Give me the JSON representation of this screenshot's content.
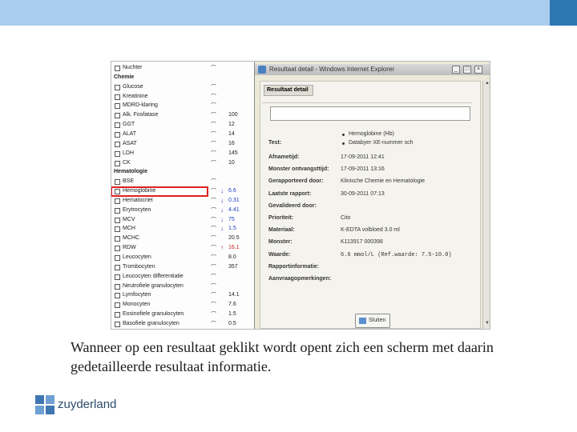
{
  "results_list": {
    "rows": [
      {
        "name": "Nuchter",
        "type": "item",
        "value": "",
        "arrow": ""
      },
      {
        "name": "Chemie",
        "type": "category",
        "value": "",
        "arrow": ""
      },
      {
        "name": "Glucose",
        "type": "item",
        "value": "",
        "arrow": ""
      },
      {
        "name": "Kreatinine",
        "type": "item",
        "value": "",
        "arrow": ""
      },
      {
        "name": "MDRD-klaring",
        "type": "item",
        "value": "",
        "arrow": ""
      },
      {
        "name": "Alk. Fosfatase",
        "type": "item",
        "value": "100",
        "arrow": ""
      },
      {
        "name": "GGT",
        "type": "item",
        "value": "12",
        "arrow": ""
      },
      {
        "name": "ALAT",
        "type": "item",
        "value": "14",
        "arrow": ""
      },
      {
        "name": "ASAT",
        "type": "item",
        "value": "16",
        "arrow": ""
      },
      {
        "name": "LDH",
        "type": "item",
        "value": "145",
        "arrow": ""
      },
      {
        "name": "CK",
        "type": "item",
        "value": "10",
        "arrow": ""
      },
      {
        "name": "Hematologie",
        "type": "category",
        "value": "",
        "arrow": ""
      },
      {
        "name": "BSE",
        "type": "item",
        "value": "",
        "arrow": ""
      },
      {
        "name": "Hemoglobine",
        "type": "item",
        "value": "6.6",
        "arrow": "down",
        "highlight": true
      },
      {
        "name": "Hematocriet",
        "type": "item",
        "value": "0.31",
        "arrow": "down"
      },
      {
        "name": "Erytrocyten",
        "type": "item",
        "value": "4.41",
        "arrow": "down"
      },
      {
        "name": "MCV",
        "type": "item",
        "value": "75",
        "arrow": "down"
      },
      {
        "name": "MCH",
        "type": "item",
        "value": "1.5",
        "arrow": "down"
      },
      {
        "name": "MCHC",
        "type": "item",
        "value": "20.5",
        "arrow": ""
      },
      {
        "name": "RDW",
        "type": "item",
        "value": "16.1",
        "arrow": "up"
      },
      {
        "name": "Leucocyten",
        "type": "item",
        "value": "8.0",
        "arrow": ""
      },
      {
        "name": "Trombocyten",
        "type": "item",
        "value": "357",
        "arrow": ""
      },
      {
        "name": "Leucocyten differentiatie",
        "type": "item",
        "value": "",
        "arrow": ""
      },
      {
        "name": "Neutrofiele granulocyten",
        "type": "item",
        "value": "",
        "arrow": ""
      },
      {
        "name": "Lymfocyten",
        "type": "item",
        "value": "14.1",
        "arrow": ""
      },
      {
        "name": "Monocyten",
        "type": "item",
        "value": "7.6",
        "arrow": ""
      },
      {
        "name": "Eosinofiele granulocyten",
        "type": "item",
        "value": "1.5",
        "arrow": ""
      },
      {
        "name": "Basofiele granulocyten",
        "type": "item",
        "value": "0.5",
        "arrow": ""
      }
    ]
  },
  "window": {
    "title": "Resultaat detail - Windows Internet Explorer",
    "section_label": "Resultaat detail",
    "test_label": "Test:",
    "test_bullets": [
      "Hemoglobine (Hb)",
      "Databyer XE-nummer sch"
    ],
    "details": [
      {
        "label": "Afnametijd:",
        "value": "17-09-2011 12:41"
      },
      {
        "label": "Monster ontvangsttijd:",
        "value": "17-09-2011 13:16"
      },
      {
        "label": "Gerapporteerd door:",
        "value": "Klinische Chemie en Hematologie"
      },
      {
        "label": "Laatste rapport:",
        "value": "30-09-2011 07:13"
      },
      {
        "label": "Gevalideerd door:",
        "value": ""
      },
      {
        "label": "Prioriteit:",
        "value": "Cito"
      },
      {
        "label": "Materiaal:",
        "value": "K-EDTA volbloed 3.0 ml"
      },
      {
        "label": "Monster:",
        "value": "K113917 000398"
      },
      {
        "label": "Waarde:",
        "value": "6.6 mmol/L (Ref.waarde: 7.5-10.0)"
      },
      {
        "label": "Rapportinformatie:",
        "value": ""
      },
      {
        "label": "Aanvraagopmerkingen:",
        "value": ""
      }
    ],
    "close_button": "Sluiten"
  },
  "caption": "Wanneer op een resultaat geklikt wordt opent zich een scherm met daarin gedetailleerde resultaat informatie.",
  "logo_text": "zuyderland",
  "colors": {
    "header_band": "#a9cdec",
    "header_corner": "#2d77b5",
    "highlight": "#e01f1f",
    "arrow_down": "#1f3fc4",
    "arrow_up": "#d11a1a"
  }
}
